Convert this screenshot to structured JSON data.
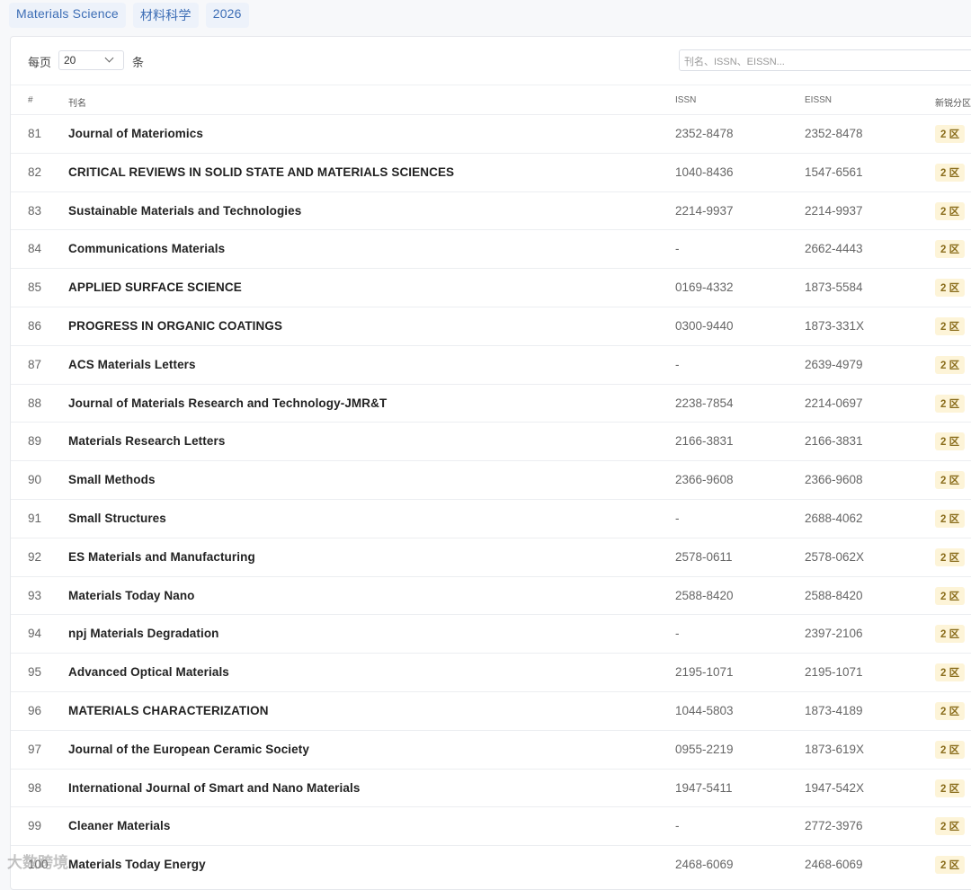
{
  "tags": [
    "Materials Science",
    "材料科学",
    "2026"
  ],
  "toolbar": {
    "per_page_label": "每页",
    "page_size": "20",
    "per_page_unit": "条",
    "search_placeholder": "刊名、ISSN、EISSN..."
  },
  "headers": {
    "num": "#",
    "name": "刊名",
    "issn": "ISSN",
    "eissn": "EISSN",
    "zone": "新锐分区"
  },
  "rows": [
    {
      "num": "81",
      "name": "Journal of Materiomics",
      "issn": "2352-8478",
      "eissn": "2352-8478",
      "zone": "2 区"
    },
    {
      "num": "82",
      "name": "CRITICAL REVIEWS IN SOLID STATE AND MATERIALS SCIENCES",
      "issn": "1040-8436",
      "eissn": "1547-6561",
      "zone": "2 区"
    },
    {
      "num": "83",
      "name": "Sustainable Materials and Technologies",
      "issn": "2214-9937",
      "eissn": "2214-9937",
      "zone": "2 区"
    },
    {
      "num": "84",
      "name": "Communications Materials",
      "issn": "-",
      "eissn": "2662-4443",
      "zone": "2 区"
    },
    {
      "num": "85",
      "name": "APPLIED SURFACE SCIENCE",
      "issn": "0169-4332",
      "eissn": "1873-5584",
      "zone": "2 区"
    },
    {
      "num": "86",
      "name": "PROGRESS IN ORGANIC COATINGS",
      "issn": "0300-9440",
      "eissn": "1873-331X",
      "zone": "2 区"
    },
    {
      "num": "87",
      "name": "ACS Materials Letters",
      "issn": "-",
      "eissn": "2639-4979",
      "zone": "2 区"
    },
    {
      "num": "88",
      "name": "Journal of Materials Research and Technology-JMR&T",
      "issn": "2238-7854",
      "eissn": "2214-0697",
      "zone": "2 区"
    },
    {
      "num": "89",
      "name": "Materials Research Letters",
      "issn": "2166-3831",
      "eissn": "2166-3831",
      "zone": "2 区"
    },
    {
      "num": "90",
      "name": "Small Methods",
      "issn": "2366-9608",
      "eissn": "2366-9608",
      "zone": "2 区"
    },
    {
      "num": "91",
      "name": "Small Structures",
      "issn": "-",
      "eissn": "2688-4062",
      "zone": "2 区"
    },
    {
      "num": "92",
      "name": "ES Materials and Manufacturing",
      "issn": "2578-0611",
      "eissn": "2578-062X",
      "zone": "2 区"
    },
    {
      "num": "93",
      "name": "Materials Today Nano",
      "issn": "2588-8420",
      "eissn": "2588-8420",
      "zone": "2 区"
    },
    {
      "num": "94",
      "name": "npj Materials Degradation",
      "issn": "-",
      "eissn": "2397-2106",
      "zone": "2 区"
    },
    {
      "num": "95",
      "name": "Advanced Optical Materials",
      "issn": "2195-1071",
      "eissn": "2195-1071",
      "zone": "2 区"
    },
    {
      "num": "96",
      "name": "MATERIALS CHARACTERIZATION",
      "issn": "1044-5803",
      "eissn": "1873-4189",
      "zone": "2 区"
    },
    {
      "num": "97",
      "name": "Journal of the European Ceramic Society",
      "issn": "0955-2219",
      "eissn": "1873-619X",
      "zone": "2 区"
    },
    {
      "num": "98",
      "name": "International Journal of Smart and Nano Materials",
      "issn": "1947-5411",
      "eissn": "1947-542X",
      "zone": "2 区"
    },
    {
      "num": "99",
      "name": "Cleaner Materials",
      "issn": "-",
      "eissn": "2772-3976",
      "zone": "2 区"
    },
    {
      "num": "100",
      "name": "Materials Today Energy",
      "issn": "2468-6069",
      "eissn": "2468-6069",
      "zone": "2 区"
    }
  ],
  "watermark": "大数跨境"
}
